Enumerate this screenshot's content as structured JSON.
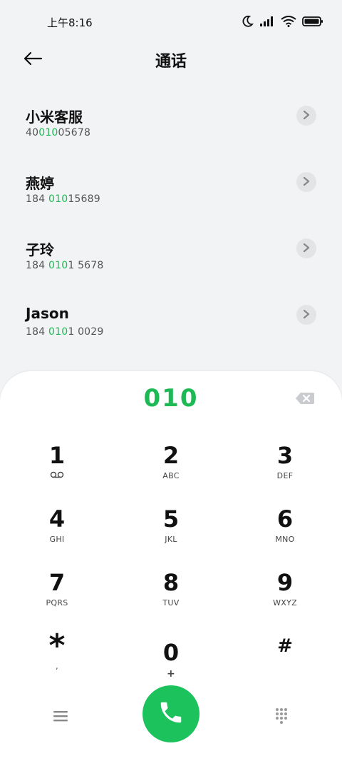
{
  "status": {
    "time": "上午8:16",
    "icons": [
      "moon-icon",
      "signal-icon",
      "wifi-icon",
      "battery-icon"
    ]
  },
  "header": {
    "title": "通话",
    "back_icon": "back-arrow-icon"
  },
  "contacts": [
    {
      "name": "小米客服",
      "num_pre": "40",
      "num_hl": "010",
      "num_post": "05678"
    },
    {
      "name": "燕婷",
      "num_pre": "184 ",
      "num_hl": "010",
      "num_post": "15689"
    },
    {
      "name": "子玲",
      "num_pre": "184 ",
      "num_hl": "010",
      "num_post": "1 5678"
    },
    {
      "name": "Jason",
      "num_pre": "184 ",
      "num_hl": "010",
      "num_post": "1 0029"
    }
  ],
  "dialpad": {
    "display": "010",
    "keys": [
      {
        "digit": "1",
        "sub": ""
      },
      {
        "digit": "2",
        "sub": "ABC"
      },
      {
        "digit": "3",
        "sub": "DEF"
      },
      {
        "digit": "4",
        "sub": "GHI"
      },
      {
        "digit": "5",
        "sub": "JKL"
      },
      {
        "digit": "6",
        "sub": "MNO"
      },
      {
        "digit": "7",
        "sub": "PQRS"
      },
      {
        "digit": "8",
        "sub": "TUV"
      },
      {
        "digit": "9",
        "sub": "WXYZ"
      },
      {
        "digit": "*",
        "sub": ","
      },
      {
        "digit": "0",
        "sub": "+"
      },
      {
        "digit": "#",
        "sub": ""
      }
    ]
  },
  "colors": {
    "accent": "#1db954",
    "call_button": "#1cc25b",
    "background": "#f2f3f5"
  }
}
